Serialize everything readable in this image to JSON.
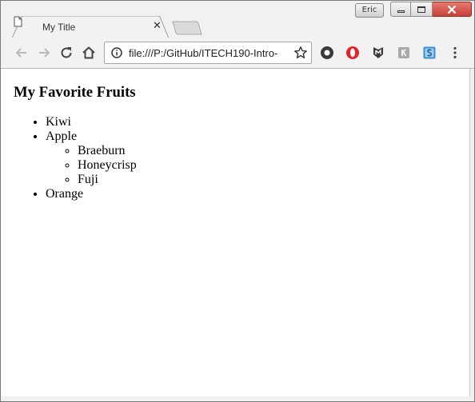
{
  "window": {
    "profile_label": "Eric",
    "tab_title": "My Title",
    "tab_close_glyph": "✕",
    "url": "file:///P:/GitHub/ITECH190-Intro-"
  },
  "page": {
    "heading": "My Favorite Fruits",
    "fruits": [
      {
        "label": "Kiwi"
      },
      {
        "label": "Apple",
        "varieties": [
          "Braeburn",
          "Honeycrisp",
          "Fuji"
        ]
      },
      {
        "label": "Orange"
      }
    ]
  },
  "extensions": [
    {
      "icon": "record-icon",
      "color": "#333333"
    },
    {
      "icon": "opera-icon",
      "color": "#e0262c"
    },
    {
      "icon": "shield-m-icon",
      "color": "#333333"
    },
    {
      "icon": "puzzle-k-icon",
      "color": "#9a9a9a"
    },
    {
      "icon": "s-square-icon",
      "color": "#3b8fd1"
    }
  ],
  "colors": {
    "close_button": "#c6413a",
    "toolbar_bg": "#f2f2f2"
  }
}
